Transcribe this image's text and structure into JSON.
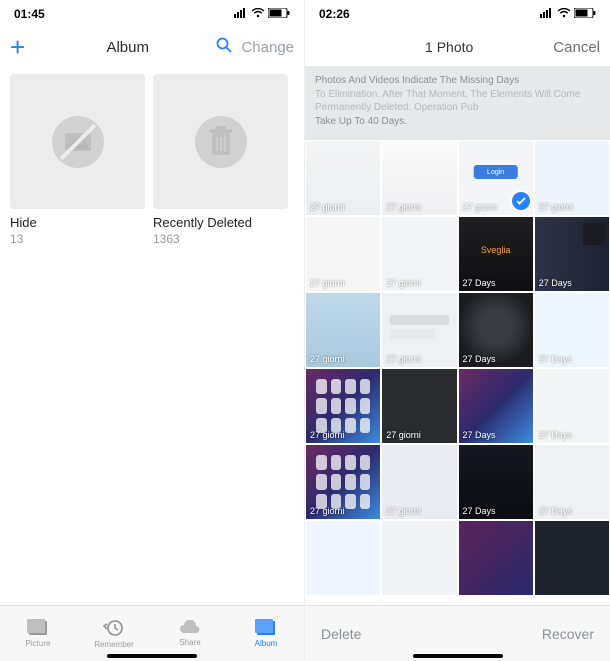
{
  "left": {
    "status": {
      "time": "01:45"
    },
    "nav": {
      "title": "Album",
      "change": "Change",
      "plus": "+"
    },
    "albums": [
      {
        "label": "Hide",
        "count": "13"
      },
      {
        "label": "Recently Deleted",
        "count": "1363"
      }
    ],
    "tabs": {
      "pictures": "Picture",
      "remember": "Remember",
      "share": "Share",
      "album": "Album"
    }
  },
  "right": {
    "status": {
      "time": "02:26"
    },
    "nav": {
      "count": "1 Photo",
      "cancel": "Cancel"
    },
    "banner": {
      "l1": "Photos And Videos Indicate The Missing Days",
      "l2": "To Elimination. After That Moment, The Elements Will Come",
      "l3": "Permanently Deleted. Operation Pub",
      "l4": "Take Up To 40 Days."
    },
    "days_it": "27 giorni",
    "days_en": "27 Days",
    "login": "Login",
    "sveglia": "Sveglia",
    "actions": {
      "delete": "Delete",
      "recover": "Recover"
    }
  }
}
